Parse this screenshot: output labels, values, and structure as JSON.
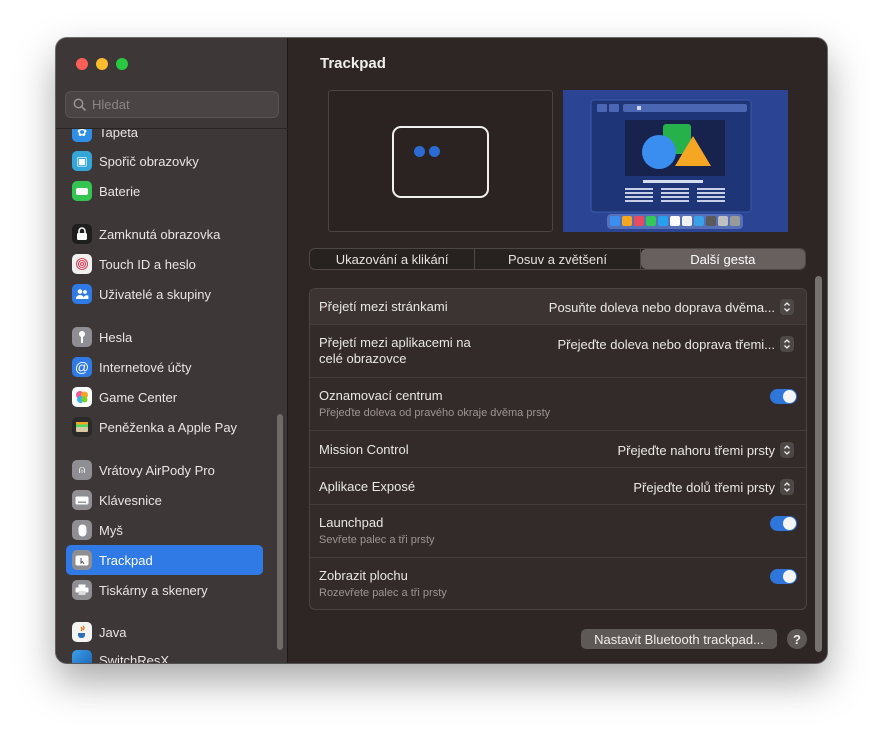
{
  "window": {
    "title": "Trackpad"
  },
  "sidebar": {
    "search_placeholder": "Hledat",
    "items": [
      {
        "label": "Tapeta",
        "icon": "wallpaper-icon",
        "color": "#2f8fe6"
      },
      {
        "label": "Spořič obrazovky",
        "icon": "screensaver-icon",
        "color": "#35a6d8"
      },
      {
        "label": "Baterie",
        "icon": "battery-icon",
        "color": "#32c552"
      },
      {
        "label": "Zamknutá obrazovka",
        "icon": "lock-icon",
        "color": "#1e1e1e"
      },
      {
        "label": "Touch ID a heslo",
        "icon": "fingerprint-icon",
        "color": "#f1f1f1"
      },
      {
        "label": "Uživatelé a skupiny",
        "icon": "users-icon",
        "color": "#2f7ae5"
      },
      {
        "label": "Hesla",
        "icon": "key-icon",
        "color": "#8e8e93"
      },
      {
        "label": "Internetové účty",
        "icon": "at-icon",
        "color": "#2f7ae5"
      },
      {
        "label": "Game Center",
        "icon": "game-center-icon",
        "color": "#ffffff"
      },
      {
        "label": "Peněženka a Apple Pay",
        "icon": "wallet-icon",
        "color": "#2a2a2a"
      },
      {
        "label": "Vrátovy AirPody Pro",
        "icon": "airpods-icon",
        "color": "#8e8e93"
      },
      {
        "label": "Klávesnice",
        "icon": "keyboard-icon",
        "color": "#8e8e93"
      },
      {
        "label": "Myš",
        "icon": "mouse-icon",
        "color": "#8e8e93"
      },
      {
        "label": "Trackpad",
        "icon": "trackpad-icon",
        "color": "#8e8e93"
      },
      {
        "label": "Tiskárny a skenery",
        "icon": "printer-icon",
        "color": "#8e8e93"
      },
      {
        "label": "Java",
        "icon": "java-icon",
        "color": "#f4f4f4"
      },
      {
        "label": "SwitchResX",
        "icon": "switchresx-icon",
        "color": "#3ba0e8"
      }
    ]
  },
  "main": {
    "title": "Trackpad",
    "tabs": [
      "Ukazování a klikání",
      "Posuv a zvětšení",
      "Další gesta"
    ],
    "active_tab": "Další gesta",
    "rows": [
      {
        "label": "Přejetí mezi stránkami",
        "value": "Posuňte doleva nebo doprava dvěma..."
      },
      {
        "label": "Přejetí mezi aplikacemi na",
        "label2": "celé obrazovce",
        "value": "Přejeďte doleva nebo doprava třemi..."
      },
      {
        "label": "Oznamovací centrum",
        "sub": "Přejeďte doleva od pravého okraje dvěma prsty",
        "toggle": true
      },
      {
        "label": "Mission Control",
        "value": "Přejeďte nahoru třemi prsty"
      },
      {
        "label": "Aplikace Exposé",
        "value": "Přejeďte dolů třemi prsty"
      },
      {
        "label": "Launchpad",
        "sub": "Sevřete palec a tři prsty",
        "toggle": true
      },
      {
        "label": "Zobrazit plochu",
        "sub": "Rozevřete palec a tři prsty",
        "toggle": true
      }
    ],
    "bluetooth_button": "Nastavit Bluetooth trackpad...",
    "help_button": "?"
  }
}
